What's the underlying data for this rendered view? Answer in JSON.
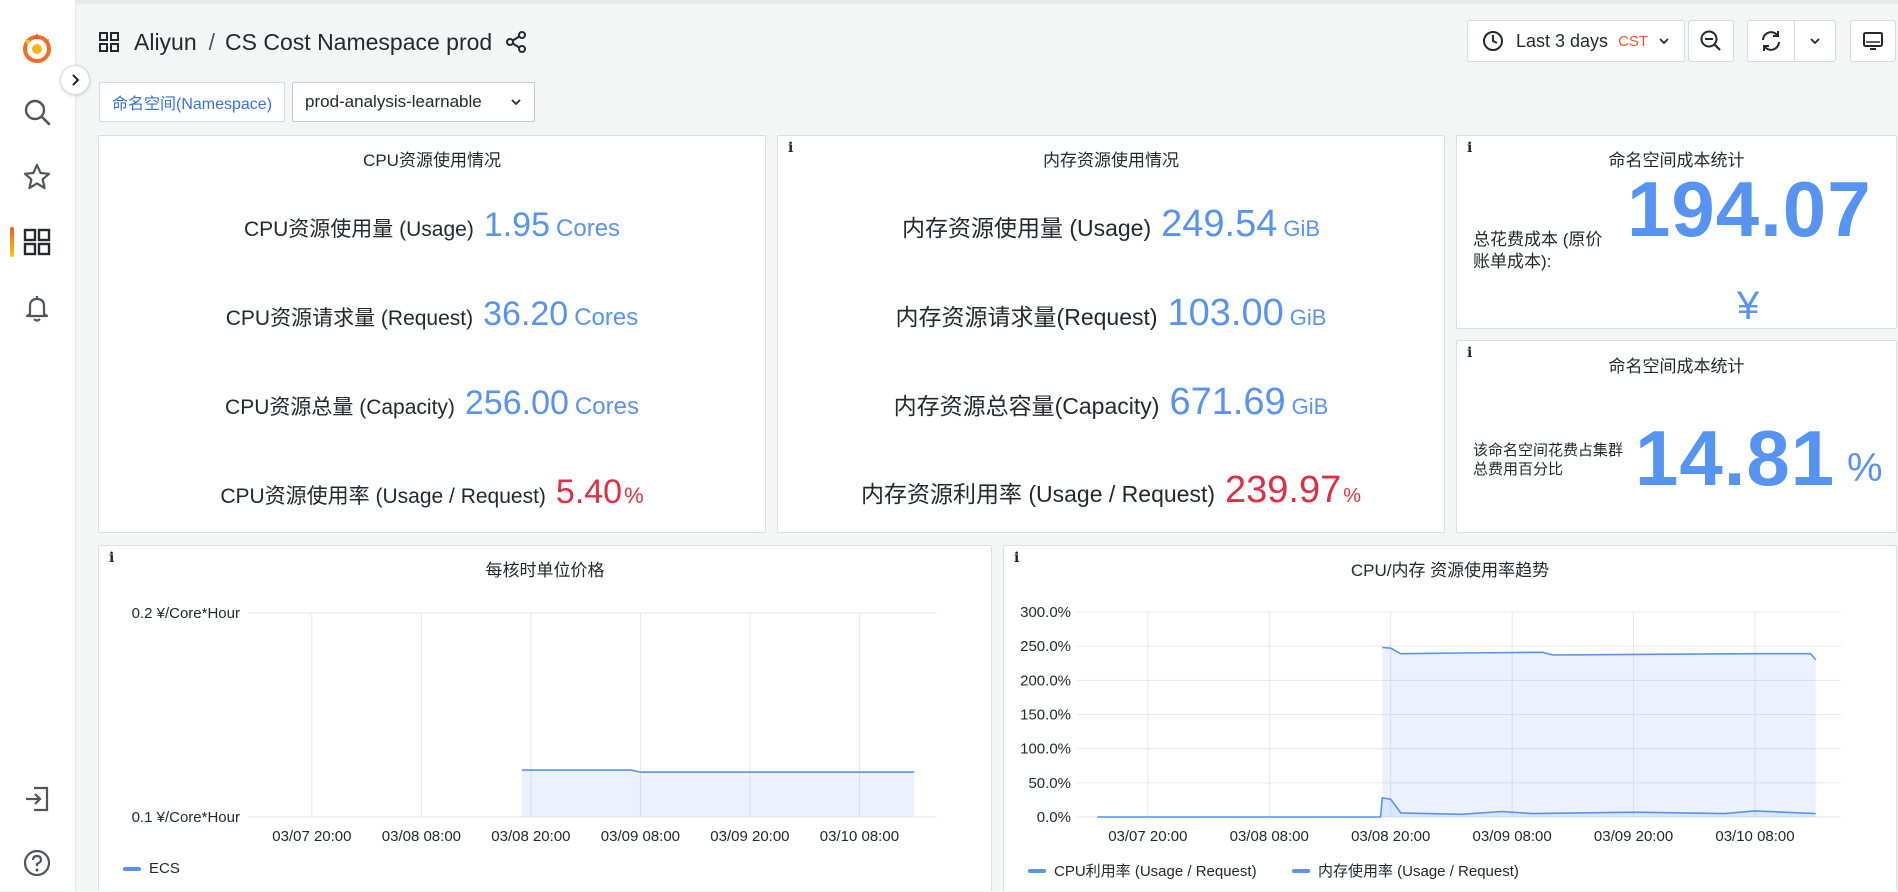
{
  "breadcrumb": {
    "folder": "Aliyun",
    "title": "CS Cost Namespace prod"
  },
  "toolbar": {
    "time_range": "Last 3 days",
    "timezone": "CST"
  },
  "variables": [
    {
      "label": "命名空间(Namespace)",
      "value": "prod-analysis-learnable"
    }
  ],
  "cpu_panel": {
    "title": "CPU资源使用情况",
    "rows": [
      {
        "label": "CPU资源使用量 (Usage)",
        "value": "1.95",
        "unit": "Cores"
      },
      {
        "label": "CPU资源请求量 (Request)",
        "value": "36.20",
        "unit": "Cores"
      },
      {
        "label": "CPU资源总量 (Capacity)",
        "value": "256.00",
        "unit": "Cores"
      },
      {
        "label": "CPU资源使用率 (Usage / Request)",
        "value": "5.40",
        "unit": "%"
      }
    ]
  },
  "mem_panel": {
    "info": "i",
    "title": "内存资源使用情况",
    "rows": [
      {
        "label": "内存资源使用量 (Usage)",
        "value": "249.54",
        "unit": "GiB"
      },
      {
        "label": "内存资源请求量(Request)",
        "value": "103.00",
        "unit": "GiB"
      },
      {
        "label": "内存资源总容量(Capacity)",
        "value": "671.69",
        "unit": "GiB"
      },
      {
        "label": "内存资源利用率 (Usage / Request)",
        "value": "239.97",
        "unit": "%"
      }
    ]
  },
  "cost_panel": {
    "info": "i",
    "title": "命名空间成本统计",
    "label": "总花费成本 (原价账单成本):",
    "value": "194.07",
    "unit": "¥"
  },
  "share_panel": {
    "info": "i",
    "title": "命名空间成本统计",
    "label": "该命名空间花费占集群总费用百分比",
    "value": "14.81",
    "unit": "%"
  },
  "colors": {
    "accent": "#5794f2",
    "alert": "#e02f44"
  },
  "chart_data": [
    {
      "type": "area",
      "title": "每核时单位价格",
      "info": "i",
      "x_ticks": [
        "03/07 20:00",
        "03/08 08:00",
        "03/08 20:00",
        "03/09 08:00",
        "03/09 20:00",
        "03/10 08:00"
      ],
      "y_ticks": [
        "0.2 ¥/Core*Hour",
        "0.1 ¥/Core*Hour"
      ],
      "ylim": [
        0.1,
        0.2
      ],
      "series": [
        {
          "name": "ECS",
          "color": "#5794f2",
          "points": [
            [
              "03/08 19:00",
              0.123
            ],
            [
              "03/09 07:00",
              0.123
            ],
            [
              "03/09 08:00",
              0.122
            ],
            [
              "03/10 14:00",
              0.122
            ]
          ]
        }
      ]
    },
    {
      "type": "area",
      "title": "CPU/内存 资源使用率趋势",
      "info": "i",
      "x_ticks": [
        "03/07 20:00",
        "03/08 08:00",
        "03/08 20:00",
        "03/09 08:00",
        "03/09 20:00",
        "03/10 08:00"
      ],
      "y_ticks": [
        "300.0%",
        "250.0%",
        "200.0%",
        "150.0%",
        "100.0%",
        "50.0%",
        "0.0%"
      ],
      "ylim": [
        0,
        300
      ],
      "series": [
        {
          "name": "CPU利用率 (Usage / Request)",
          "color": "#5794f2",
          "points": [
            [
              "03/07 15:00",
              0
            ],
            [
              "03/08 19:00",
              0
            ],
            [
              "03/08 19:10",
              28
            ],
            [
              "03/08 20:00",
              26
            ],
            [
              "03/08 21:00",
              6
            ],
            [
              "03/09 03:00",
              4
            ],
            [
              "03/09 07:00",
              8
            ],
            [
              "03/09 10:00",
              5
            ],
            [
              "03/09 20:00",
              7
            ],
            [
              "03/10 05:00",
              5
            ],
            [
              "03/10 08:00",
              9
            ],
            [
              "03/10 14:00",
              5
            ]
          ]
        },
        {
          "name": "内存使用率 (Usage / Request)",
          "color": "#5794f2",
          "points": [
            [
              "03/08 19:10",
              248
            ],
            [
              "03/08 20:00",
              247
            ],
            [
              "03/08 21:00",
              239
            ],
            [
              "03/09 03:00",
              240
            ],
            [
              "03/09 11:00",
              241
            ],
            [
              "03/09 12:00",
              237
            ],
            [
              "03/09 20:00",
              238
            ],
            [
              "03/10 08:00",
              239
            ],
            [
              "03/10 13:30",
              239
            ],
            [
              "03/10 14:00",
              230
            ]
          ]
        }
      ]
    }
  ]
}
